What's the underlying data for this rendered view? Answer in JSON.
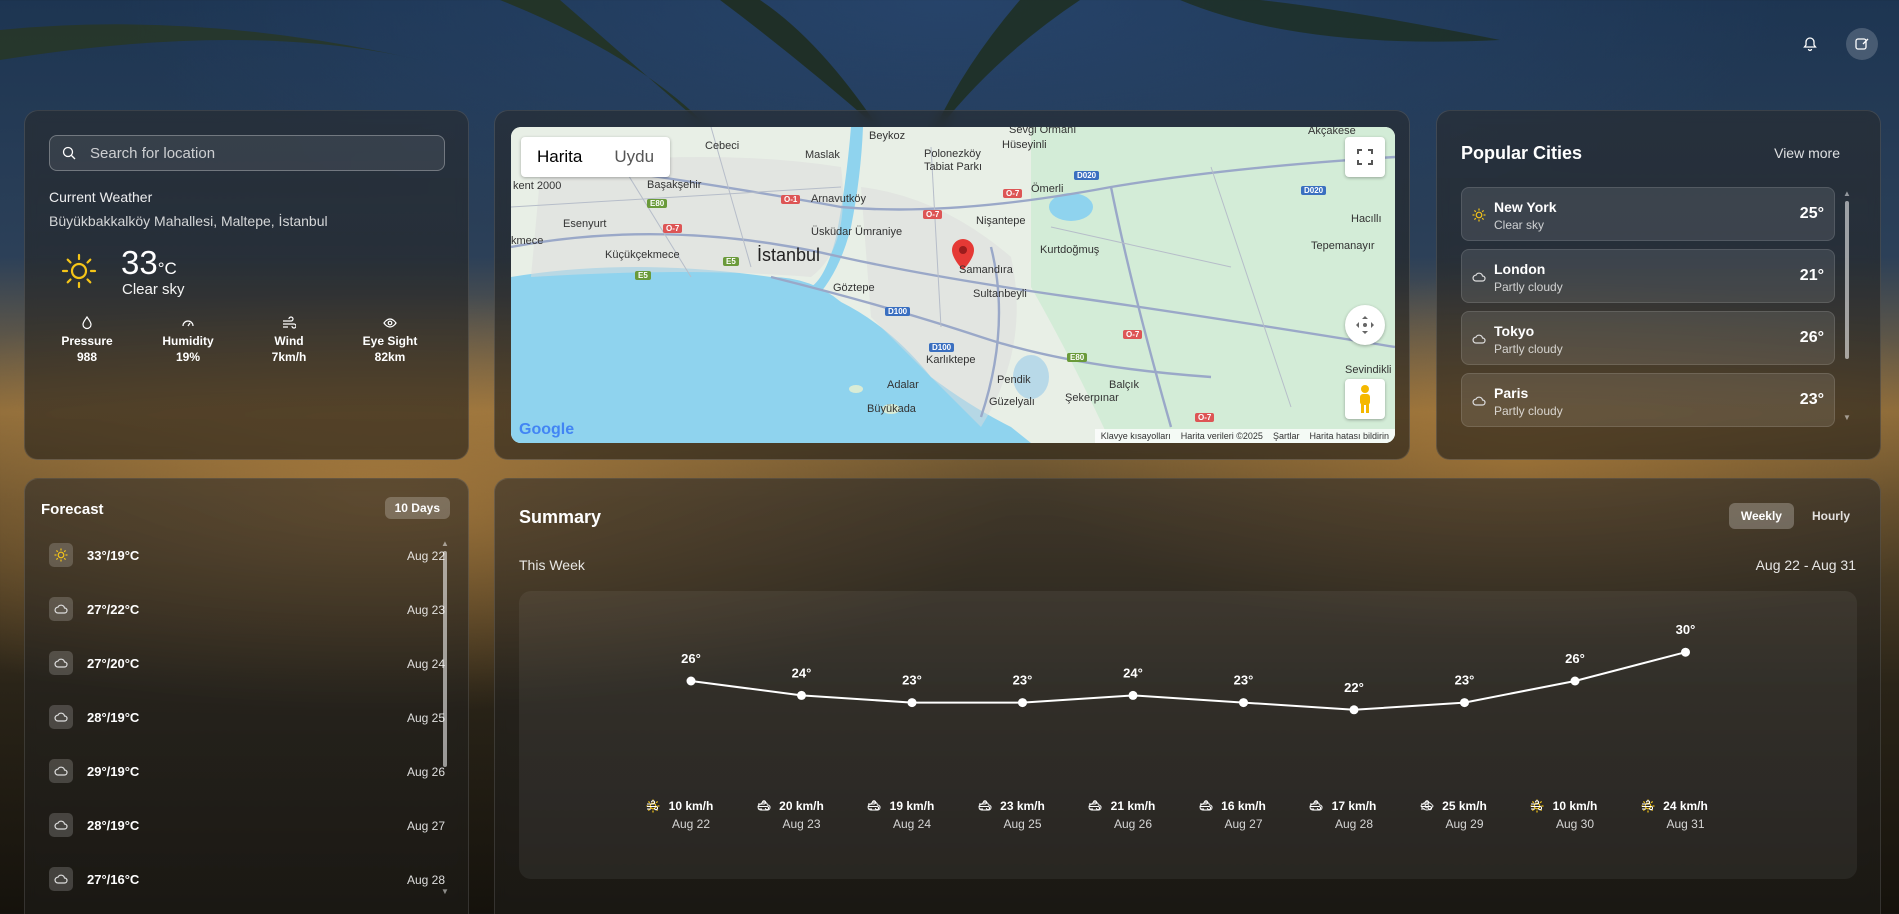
{
  "current": {
    "search_placeholder": "Search for location",
    "label": "Current Weather",
    "location": "Büyükbakkalköy Mahallesi, Maltepe, İstanbul",
    "temp": "33",
    "unit": "°C",
    "condition": "Clear sky",
    "stats": [
      {
        "label": "Pressure",
        "value": "988",
        "icon": "pressure-icon"
      },
      {
        "label": "Humidity",
        "value": "19%",
        "icon": "humidity-icon"
      },
      {
        "label": "Wind",
        "value": "7km/h",
        "icon": "wind-icon"
      },
      {
        "label": "Eye Sight",
        "value": "82km",
        "icon": "eye-icon"
      }
    ]
  },
  "map": {
    "tab_map": "Harita",
    "tab_satellite": "Uydu",
    "footer": [
      "Klavye kısayolları",
      "Harita verileri ©2025",
      "Şartlar",
      "Harita hatası bildirin"
    ],
    "logo": "Google",
    "labels": [
      "Beykoz",
      "Sevgi Ormanı",
      "Akçakese",
      "Cebeci",
      "Maslak",
      "Polonezköy Tabiat Parkı",
      "Hüseyinli",
      "kent 2000",
      "Başakşehir",
      "Arnavutköy",
      "Ömerli",
      "Esenyurt",
      "Üsküdar Ümraniye",
      "Nişantepe",
      "Hacıllı",
      "kmece",
      "Küçükçekmece",
      "İstanbul",
      "Kurtdoğmuş",
      "Tepemanayır",
      "Göztepe",
      "Samandıra",
      "Sultanbeyli",
      "Karlıktepe",
      "Pendik",
      "Adalar",
      "Balçık",
      "Sevindikli",
      "Büyükada",
      "Güzelyalı",
      "Şekerpınar"
    ],
    "roads": [
      "O-1",
      "O-7",
      "E80",
      "E5",
      "D100",
      "D020",
      "D020",
      "O-7",
      "O-7",
      "E80",
      "D100",
      "O-7",
      "O-7",
      "E5"
    ]
  },
  "popular": {
    "title": "Popular Cities",
    "view_more": "View more",
    "cities": [
      {
        "name": "New York",
        "condition": "Clear sky",
        "temp": "25°",
        "icon": "sun-icon"
      },
      {
        "name": "London",
        "condition": "Partly cloudy",
        "temp": "21°",
        "icon": "cloud-icon"
      },
      {
        "name": "Tokyo",
        "condition": "Partly cloudy",
        "temp": "26°",
        "icon": "cloud-icon"
      },
      {
        "name": "Paris",
        "condition": "Partly cloudy",
        "temp": "23°",
        "icon": "cloud-icon"
      }
    ]
  },
  "forecast": {
    "title": "Forecast",
    "badge": "10 Days",
    "days": [
      {
        "temps": "33°/19°C",
        "date": "Aug 22",
        "icon": "sun-icon"
      },
      {
        "temps": "27°/22°C",
        "date": "Aug 23",
        "icon": "cloud-icon"
      },
      {
        "temps": "27°/20°C",
        "date": "Aug 24",
        "icon": "cloud-icon"
      },
      {
        "temps": "28°/19°C",
        "date": "Aug 25",
        "icon": "cloud-icon"
      },
      {
        "temps": "29°/19°C",
        "date": "Aug 26",
        "icon": "cloud-icon"
      },
      {
        "temps": "28°/19°C",
        "date": "Aug 27",
        "icon": "cloud-icon"
      },
      {
        "temps": "27°/16°C",
        "date": "Aug 28",
        "icon": "cloud-icon"
      }
    ]
  },
  "summary": {
    "title": "Summary",
    "tab_weekly": "Weekly",
    "tab_hourly": "Hourly",
    "week_label": "This Week",
    "range": "Aug 22 - Aug 31"
  },
  "chart_data": {
    "type": "line",
    "categories": [
      "Aug 22",
      "Aug 23",
      "Aug 24",
      "Aug 25",
      "Aug 26",
      "Aug 27",
      "Aug 28",
      "Aug 29",
      "Aug 30",
      "Aug 31"
    ],
    "values": [
      26,
      24,
      23,
      23,
      24,
      23,
      22,
      23,
      26,
      30
    ],
    "value_labels": [
      "26°",
      "24°",
      "23°",
      "23°",
      "24°",
      "23°",
      "22°",
      "23°",
      "26°",
      "30°"
    ],
    "wind": [
      "10 km/h",
      "20 km/h",
      "19 km/h",
      "23 km/h",
      "21 km/h",
      "16 km/h",
      "17 km/h",
      "25 km/h",
      "10 km/h",
      "24 km/h"
    ],
    "icons": [
      "sun-icon",
      "cloud-icon",
      "cloud-icon",
      "cloud-icon",
      "cloud-icon",
      "cloud-icon",
      "cloud-icon",
      "eye-icon",
      "sun-icon",
      "sun-icon"
    ],
    "ylim": [
      18,
      32
    ],
    "grid": false
  },
  "colors": {
    "sun": "#f5c518",
    "line": "#ffffff",
    "map_water": "#8fd3ee",
    "map_land": "#e8efe6",
    "marker": "#e53935"
  }
}
